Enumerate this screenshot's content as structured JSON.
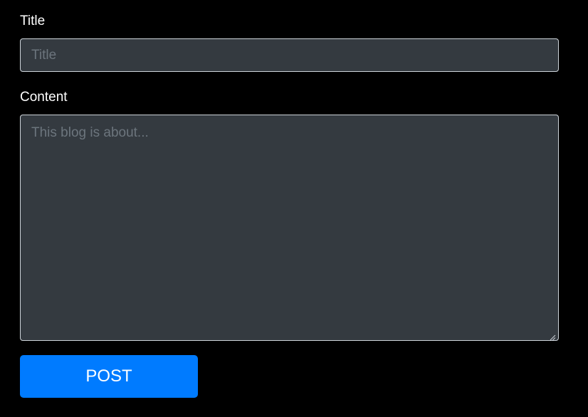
{
  "form": {
    "title_label": "Title",
    "title_placeholder": "Title",
    "title_value": "",
    "content_label": "Content",
    "content_placeholder": "This blog is about...",
    "content_value": "",
    "post_label": "POST"
  },
  "colors": {
    "background": "#000000",
    "field_background": "#343a40",
    "field_border": "#ced4da",
    "placeholder": "#6c757d",
    "button_primary": "#007bff",
    "text": "#ffffff"
  },
  "icons": {
    "resize_handle": "resize-grip-icon"
  }
}
